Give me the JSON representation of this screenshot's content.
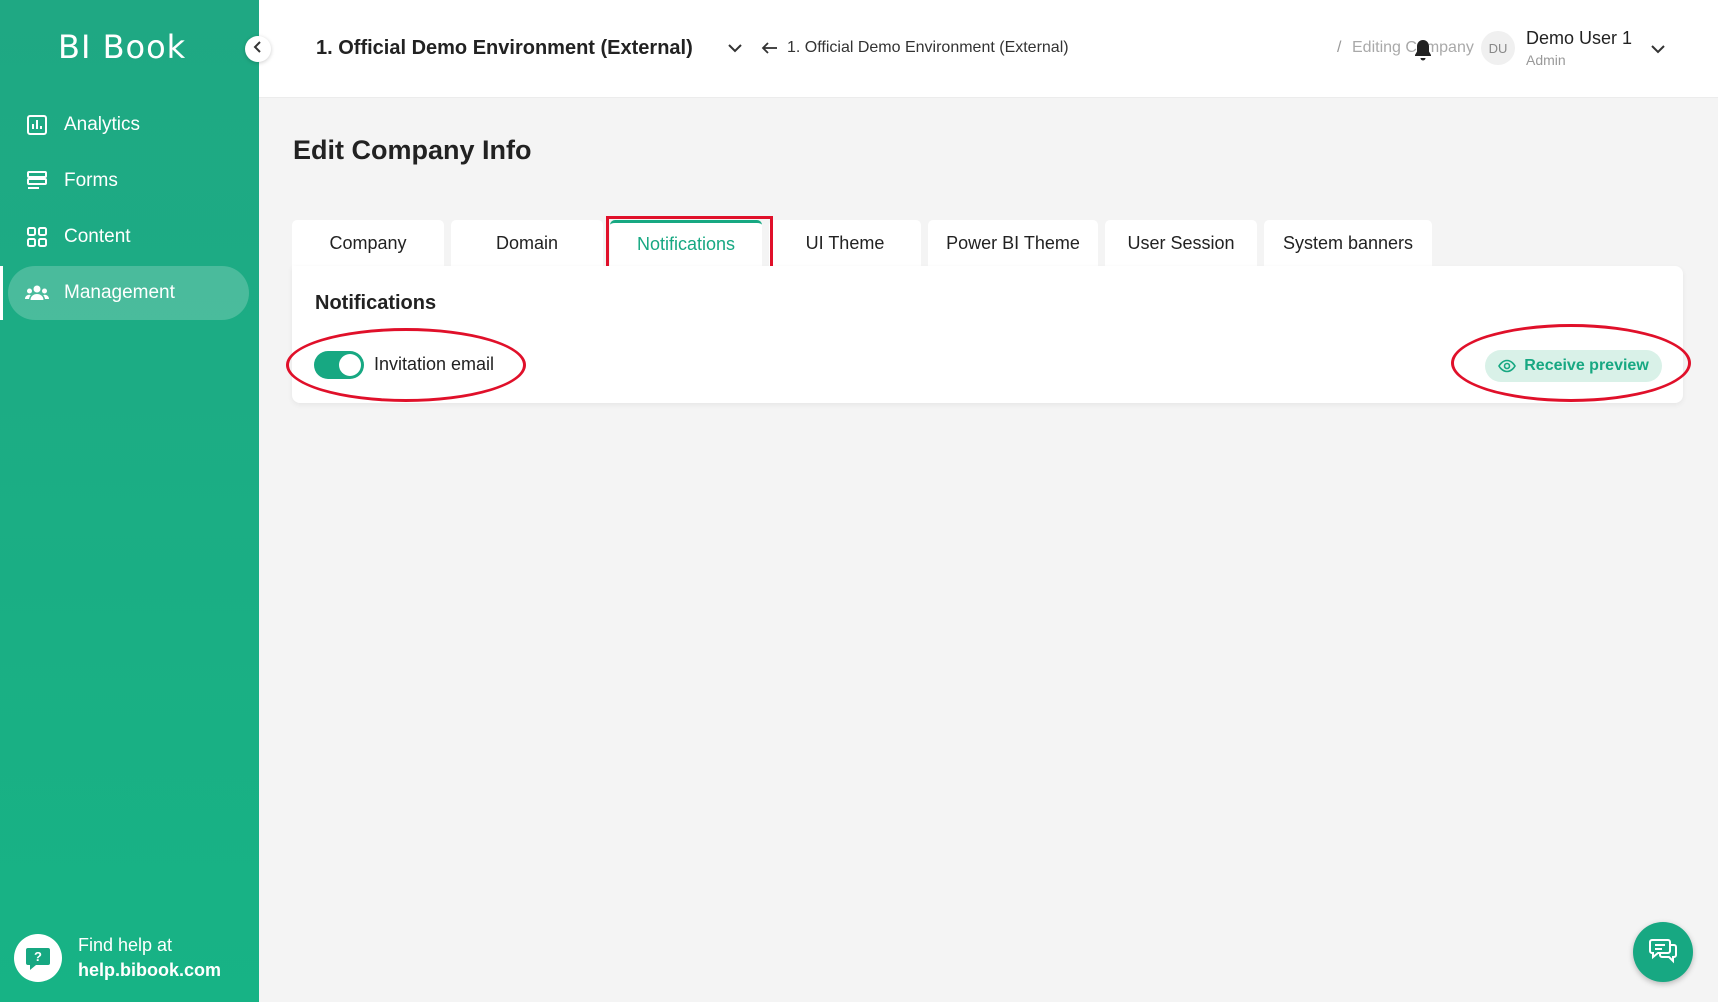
{
  "app": {
    "logo": "BI Book"
  },
  "sidebar": {
    "items": [
      {
        "label": "Analytics",
        "icon": "analytics-icon",
        "active": false
      },
      {
        "label": "Forms",
        "icon": "forms-icon",
        "active": false
      },
      {
        "label": "Content",
        "icon": "content-icon",
        "active": false
      },
      {
        "label": "Management",
        "icon": "management-icon",
        "active": true
      }
    ],
    "help": {
      "line1": "Find help at",
      "line2": "help.bibook.com"
    }
  },
  "header": {
    "environment": "1. Official Demo Environment (External)",
    "breadcrumb": {
      "parent": "1. Official Demo Environment (External)",
      "separator": "/",
      "current": "Editing Company"
    },
    "user": {
      "initials": "DU",
      "name": "Demo User 1",
      "role": "Admin"
    }
  },
  "main": {
    "title": "Edit Company Info",
    "tabs": [
      {
        "label": "Company",
        "active": false
      },
      {
        "label": "Domain",
        "active": false
      },
      {
        "label": "Notifications",
        "active": true
      },
      {
        "label": "UI Theme",
        "active": false
      },
      {
        "label": "Power BI Theme",
        "active": false
      },
      {
        "label": "User Session",
        "active": false
      },
      {
        "label": "System banners",
        "active": false
      }
    ],
    "panel": {
      "title": "Notifications",
      "toggle_label": "Invitation email",
      "toggle_on": true,
      "preview_label": "Receive preview"
    }
  },
  "colors": {
    "brand": "#17a882",
    "highlight": "#e0102a"
  }
}
